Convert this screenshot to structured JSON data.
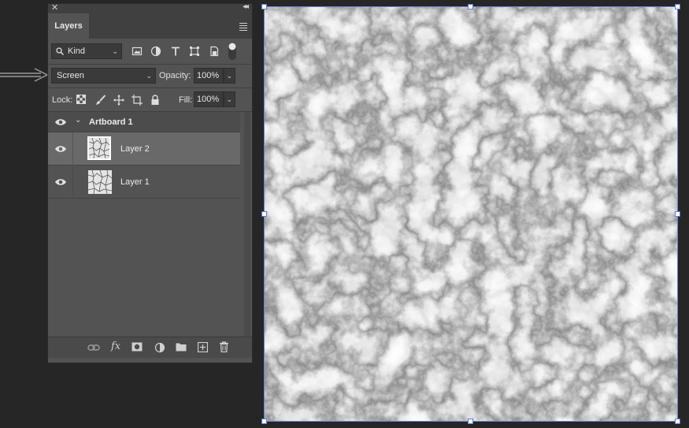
{
  "panel": {
    "tab_title": "Layers",
    "filter": {
      "kind_label": "Kind"
    },
    "blend": {
      "mode": "Screen",
      "opacity_label": "Opacity:",
      "opacity_value": "100%"
    },
    "lock": {
      "lock_label": "Lock:",
      "fill_label": "Fill:",
      "fill_value": "100%"
    },
    "artboard": {
      "name": "Artboard 1"
    },
    "layers": [
      {
        "name": "Layer 2",
        "selected": true
      },
      {
        "name": "Layer 1",
        "selected": false
      }
    ]
  },
  "icons": {
    "close": "close-icon",
    "collapse": "double-chevron-icon",
    "menu": "panel-menu-icon",
    "search": "search-icon",
    "pixel": "image-filter-icon",
    "adjust": "adjustment-filter-icon",
    "type": "type-filter-icon",
    "shape": "shape-filter-icon",
    "smart": "smart-object-filter-icon",
    "toggle": "filter-toggle-icon",
    "eye": "eye-icon",
    "lock_pixels": "lock-transparent-icon",
    "lock_brush": "lock-image-icon",
    "lock_move": "lock-position-icon",
    "lock_artboard": "lock-artboard-icon",
    "lock_all": "lock-all-icon",
    "link": "link-layers-icon",
    "fx": "fx-icon",
    "mask": "add-mask-icon",
    "adjustment": "new-adjustment-icon",
    "group": "new-group-icon",
    "new_layer": "new-layer-icon",
    "trash": "delete-layer-icon"
  },
  "colors": {
    "panel_bg": "#535353",
    "selected_row": "#696969",
    "artboard_border": "#6d84d2",
    "canvas_bg": "#262626"
  }
}
